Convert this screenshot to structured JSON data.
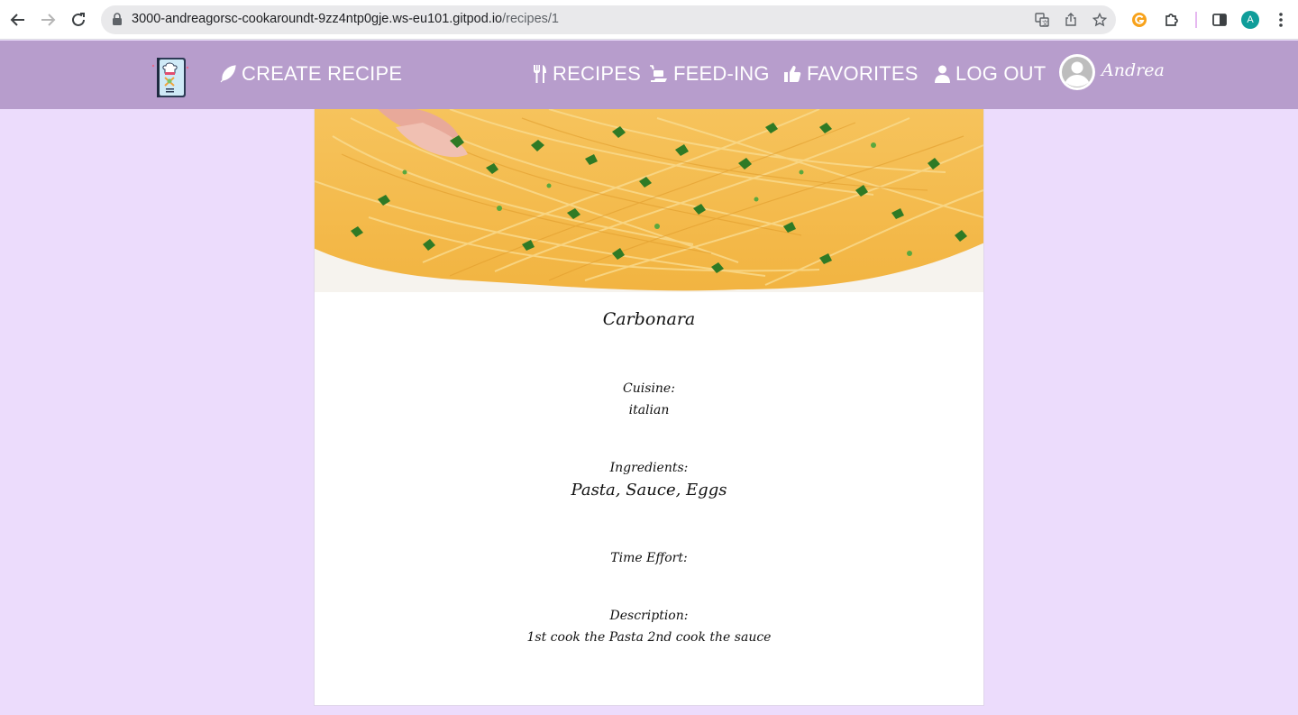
{
  "browser": {
    "url_host": "3000-andreagorsc-cookaroundt-9zz4ntp0gje.ws-eu101.gitpod.io",
    "url_path": "/recipes/1",
    "profile_initial": "A",
    "icons": [
      "back-icon",
      "forward-icon",
      "reload-icon",
      "lock-icon",
      "translate-icon",
      "share-icon",
      "bookmark-star-icon",
      "extension-g-icon",
      "extensions-puzzle-icon",
      "side-panel-icon",
      "profile-avatar",
      "more-menu-icon"
    ]
  },
  "navbar": {
    "create_recipe": "Create Recipe",
    "recipes": "Recipes",
    "feeding": "Feed-ing",
    "favorites": "Favorites",
    "logout": "Log Out",
    "username": "Andrea",
    "colors": {
      "bar": "#b79dcc",
      "text": "#ffffff",
      "page": "#ecdcfc"
    }
  },
  "recipe": {
    "title": "Carbonara",
    "cuisine_label": "Cuisine:",
    "cuisine": "italian",
    "ingredients_label": "Ingredients:",
    "ingredients": "Pasta, Sauce, Eggs",
    "time_label": "Time Effort:",
    "time": "",
    "description_label": "Description:",
    "description": "1st cook the Pasta 2nd cook the sauce"
  }
}
